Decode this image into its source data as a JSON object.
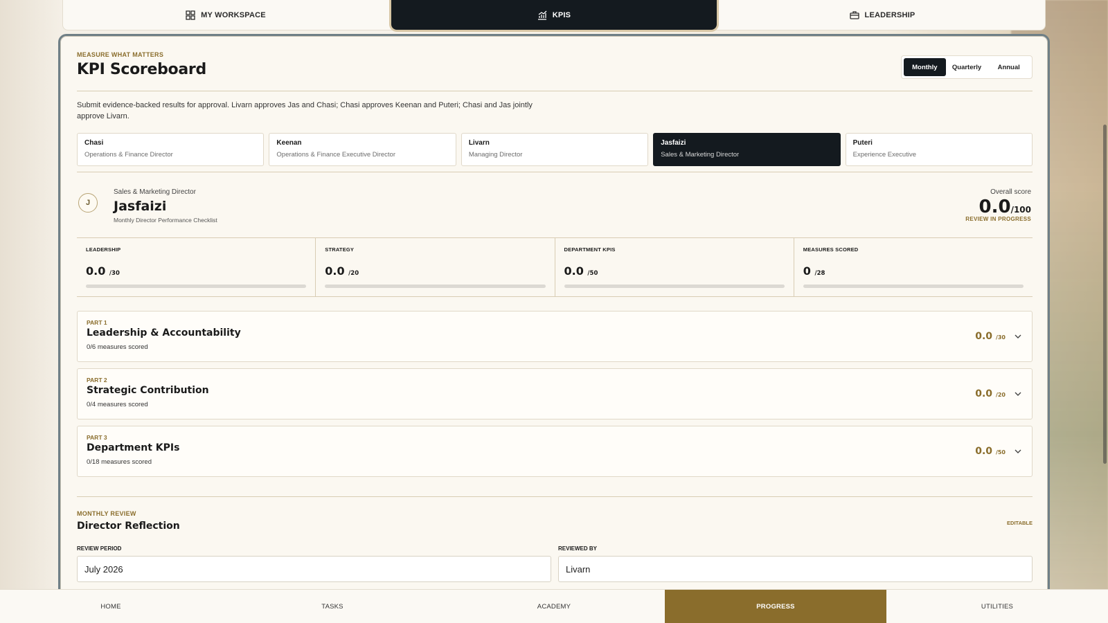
{
  "top_tabs": [
    {
      "label": "MY WORKSPACE",
      "icon": "grid-icon"
    },
    {
      "label": "KPIS",
      "icon": "chart-icon"
    },
    {
      "label": "LEADERSHIP",
      "icon": "briefcase-icon"
    }
  ],
  "header": {
    "eyebrow": "MEASURE WHAT MATTERS",
    "title": "KPI Scoreboard",
    "periods": [
      "Monthly",
      "Quarterly",
      "Annual"
    ],
    "active_period": "Monthly"
  },
  "description": "Submit evidence-backed results for approval. Livarn approves Jas and Chasi; Chasi approves Keenan and Puteri; Chasi and Jas jointly approve Livarn.",
  "directors": [
    {
      "name": "Chasi",
      "role": "Operations & Finance Director"
    },
    {
      "name": "Keenan",
      "role": "Operations & Finance Executive Director"
    },
    {
      "name": "Livarn",
      "role": "Managing Director"
    },
    {
      "name": "Jasfaizi",
      "role": "Sales & Marketing Director"
    },
    {
      "name": "Puteri",
      "role": "Experience Executive"
    }
  ],
  "profile": {
    "initial": "J",
    "role": "Sales & Marketing Director",
    "name": "Jasfaizi",
    "checklist": "Monthly Director Performance Checklist",
    "overall_label": "Overall score",
    "overall_value": "0.0",
    "overall_den": "/100",
    "status": "REVIEW IN PROGRESS"
  },
  "metrics": [
    {
      "label": "LEADERSHIP",
      "value": "0.0",
      "den": "/30",
      "progress": 0
    },
    {
      "label": "STRATEGY",
      "value": "0.0",
      "den": "/20",
      "progress": 0
    },
    {
      "label": "DEPARTMENT KPIS",
      "value": "0.0",
      "den": "/50",
      "progress": 0
    },
    {
      "label": "MEASURES SCORED",
      "value": "0",
      "den": "/28",
      "progress": 0
    }
  ],
  "parts": [
    {
      "num": "PART 1",
      "title": "Leadership & Accountability",
      "count": "0/6 measures scored",
      "score": "0.0",
      "den": "/30"
    },
    {
      "num": "PART 2",
      "title": "Strategic Contribution",
      "count": "0/4 measures scored",
      "score": "0.0",
      "den": "/20"
    },
    {
      "num": "PART 3",
      "title": "Department KPIs",
      "count": "0/18 measures scored",
      "score": "0.0",
      "den": "/50"
    }
  ],
  "review": {
    "eyebrow": "MONTHLY REVIEW",
    "title": "Director Reflection",
    "editable": "EDITABLE",
    "period_label": "REVIEW PERIOD",
    "period_value": "July 2026",
    "reviewed_label": "REVIEWED BY",
    "reviewed_value": "Livarn"
  },
  "bottom_nav": [
    {
      "label": "HOME"
    },
    {
      "label": "TASKS"
    },
    {
      "label": "ACADEMY"
    },
    {
      "label": "PROGRESS"
    },
    {
      "label": "UTILITIES"
    }
  ],
  "colors": {
    "accent": "#8a6d2c",
    "dark": "#141a1f"
  }
}
